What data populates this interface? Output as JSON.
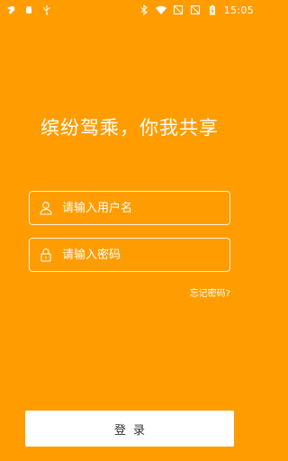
{
  "status_bar": {
    "time": "15:05",
    "left_icons": [
      "squirrel-icon",
      "android-debug-icon",
      "usb-icon"
    ],
    "right_icons": [
      "bluetooth-icon",
      "wifi-icon",
      "no-sim-icon",
      "no-sim-icon",
      "battery-icon"
    ]
  },
  "slogan": "缤纷驾乘，你我共享",
  "login_form": {
    "username_placeholder": "请输入用户名",
    "password_placeholder": "请输入密码",
    "forgot_password_label": "忘记密码?",
    "submit_label": "登录"
  },
  "colors": {
    "background": "#ff9d00",
    "text": "#ffffff",
    "button_bg": "#ffffff",
    "button_text": "#333333"
  }
}
